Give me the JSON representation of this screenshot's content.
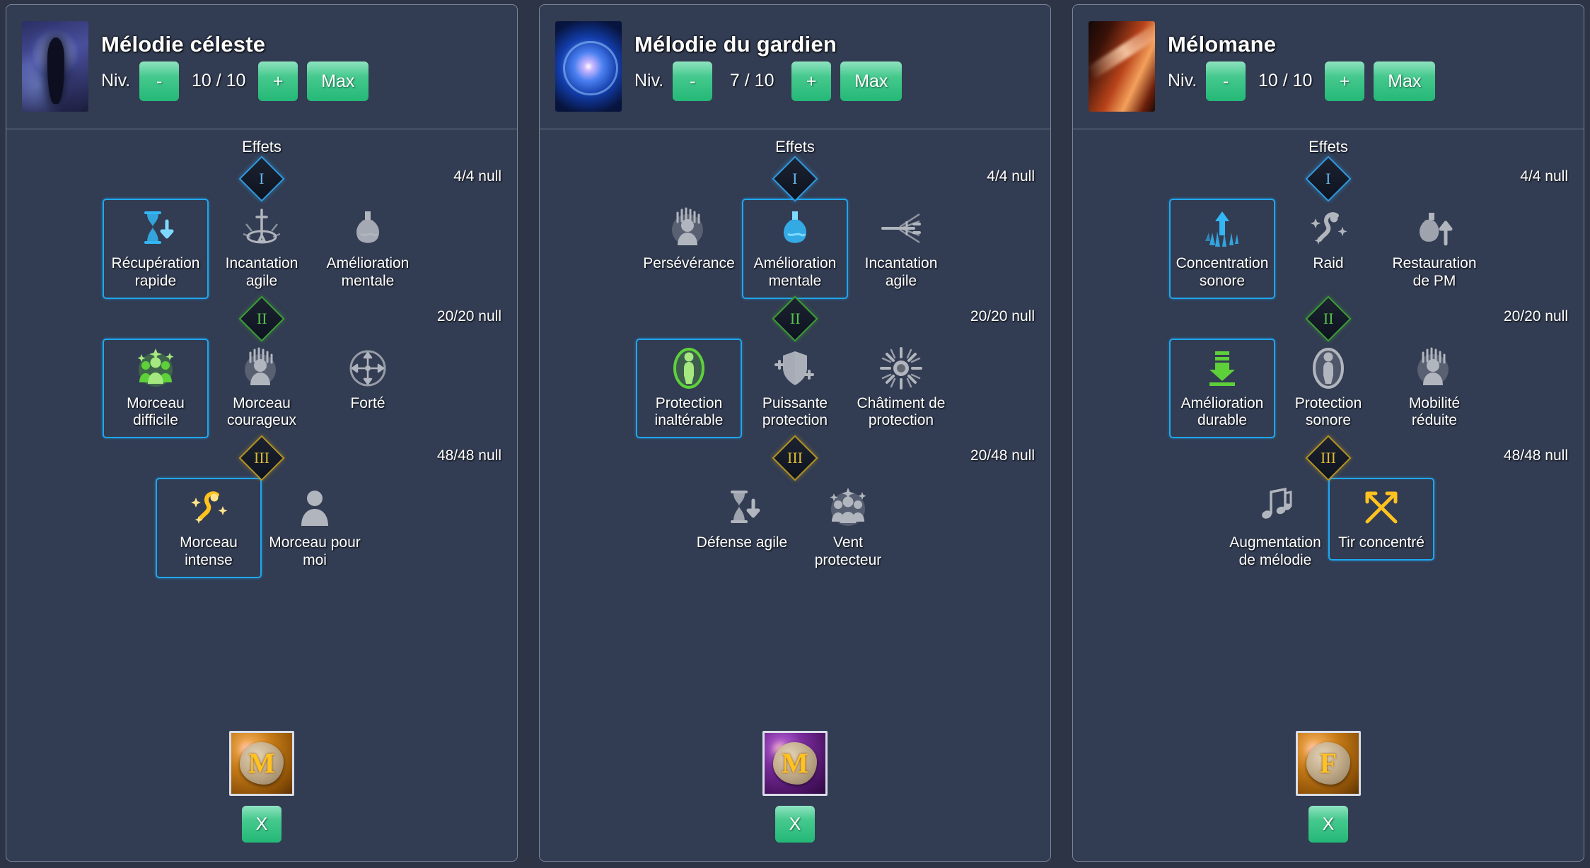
{
  "buttons": {
    "minus_label": "-",
    "plus_label": "+",
    "max_label": "Max",
    "remove_label": "X",
    "level_prefix": "Niv."
  },
  "section_label": "Effets",
  "tiers": {
    "one": "I",
    "two": "II",
    "three": "III"
  },
  "cards": [
    {
      "title": "Mélodie céleste",
      "portrait_icon": "celestial-melody-portrait",
      "level": "10 / 10",
      "effects_label": "Effets",
      "rune": {
        "glyph": "M",
        "style": "amber",
        "name": "rune-madr"
      },
      "tiers": [
        {
          "numeral": "I",
          "count": "4/4 null",
          "items": [
            {
              "label": "Récupération rapide",
              "icon": "hourglass-down-icon",
              "selected": true,
              "tone": "blue"
            },
            {
              "label": "Incantation agile",
              "icon": "sword-ring-icon",
              "selected": false,
              "tone": "grey"
            },
            {
              "label": "Amélioration mentale",
              "icon": "potion-icon",
              "selected": false,
              "tone": "grey"
            }
          ]
        },
        {
          "numeral": "II",
          "count": "20/20 null",
          "items": [
            {
              "label": "Morceau difficile",
              "icon": "group-sparkle-icon",
              "selected": true,
              "tone": "green"
            },
            {
              "label": "Morceau courageux",
              "icon": "head-rays-icon",
              "selected": false,
              "tone": "grey"
            },
            {
              "label": "Forté",
              "icon": "four-arrows-icon",
              "selected": false,
              "tone": "grey"
            }
          ]
        },
        {
          "numeral": "III",
          "count": "48/48 null",
          "items": [
            {
              "label": "Morceau intense",
              "icon": "magic-wand-icon",
              "selected": true,
              "tone": "gold"
            },
            {
              "label": "Morceau pour moi",
              "icon": "person-icon",
              "selected": false,
              "tone": "grey"
            }
          ]
        }
      ]
    },
    {
      "title": "Mélodie du gardien",
      "portrait_icon": "guardian-melody-portrait",
      "level": "7 / 10",
      "effects_label": "Effets",
      "rune": {
        "glyph": "M",
        "style": "purple",
        "name": "rune-madr"
      },
      "tiers": [
        {
          "numeral": "I",
          "count": "4/4 null",
          "items": [
            {
              "label": "Persévérance",
              "icon": "head-rays-icon",
              "selected": false,
              "tone": "grey"
            },
            {
              "label": "Amélioration mentale",
              "icon": "potion-icon",
              "selected": true,
              "tone": "blue"
            },
            {
              "label": "Incantation agile",
              "icon": "sword-rays-icon",
              "selected": false,
              "tone": "grey"
            }
          ]
        },
        {
          "numeral": "II",
          "count": "20/20 null",
          "items": [
            {
              "label": "Protection inaltérable",
              "icon": "person-aura-icon",
              "selected": true,
              "tone": "green"
            },
            {
              "label": "Puissante protection",
              "icon": "shield-plus-icon",
              "selected": false,
              "tone": "grey"
            },
            {
              "label": "Châtiment de protection",
              "icon": "sun-burst-icon",
              "selected": false,
              "tone": "grey"
            }
          ]
        },
        {
          "numeral": "III",
          "count": "20/48 null",
          "items": [
            {
              "label": "Défense agile",
              "icon": "hourglass-down-icon",
              "selected": false,
              "tone": "grey"
            },
            {
              "label": "Vent protecteur",
              "icon": "group-sparkle-icon",
              "selected": false,
              "tone": "grey"
            }
          ]
        }
      ]
    },
    {
      "title": "Mélomane",
      "portrait_icon": "melomane-portrait",
      "level": "10 / 10",
      "effects_label": "Effets",
      "rune": {
        "glyph": "F",
        "style": "amber",
        "name": "rune-fehu"
      },
      "tiers": [
        {
          "numeral": "I",
          "count": "4/4 null",
          "items": [
            {
              "label": "Concentration sonore",
              "icon": "arrow-up-burst-icon",
              "selected": true,
              "tone": "blue"
            },
            {
              "label": "Raid",
              "icon": "magic-wand-icon",
              "selected": false,
              "tone": "grey"
            },
            {
              "label": "Restauration de PM",
              "icon": "potion-up-icon",
              "selected": false,
              "tone": "grey"
            }
          ]
        },
        {
          "numeral": "II",
          "count": "20/20 null",
          "items": [
            {
              "label": "Amélioration durable",
              "icon": "arrow-down-icon",
              "selected": true,
              "tone": "green"
            },
            {
              "label": "Protection sonore",
              "icon": "person-aura-icon",
              "selected": false,
              "tone": "grey"
            },
            {
              "label": "Mobilité réduite",
              "icon": "head-rays-icon",
              "selected": false,
              "tone": "grey"
            }
          ]
        },
        {
          "numeral": "III",
          "count": "48/48 null",
          "items": [
            {
              "label": "Augmentation de mélodie",
              "icon": "music-notes-icon",
              "selected": false,
              "tone": "grey"
            },
            {
              "label": "Tir concentré",
              "icon": "bow-arrow-icon",
              "selected": true,
              "tone": "gold"
            }
          ]
        }
      ]
    }
  ],
  "colors": {
    "page_bg": "#2c3446",
    "card_bg": "#323c52",
    "card_border": "#7b8699",
    "accent_green": "#24b877",
    "select_blue": "#1fa7f0",
    "tier1": "#2f9ae0",
    "tier2": "#3c9e34",
    "tier3": "#b59420"
  }
}
